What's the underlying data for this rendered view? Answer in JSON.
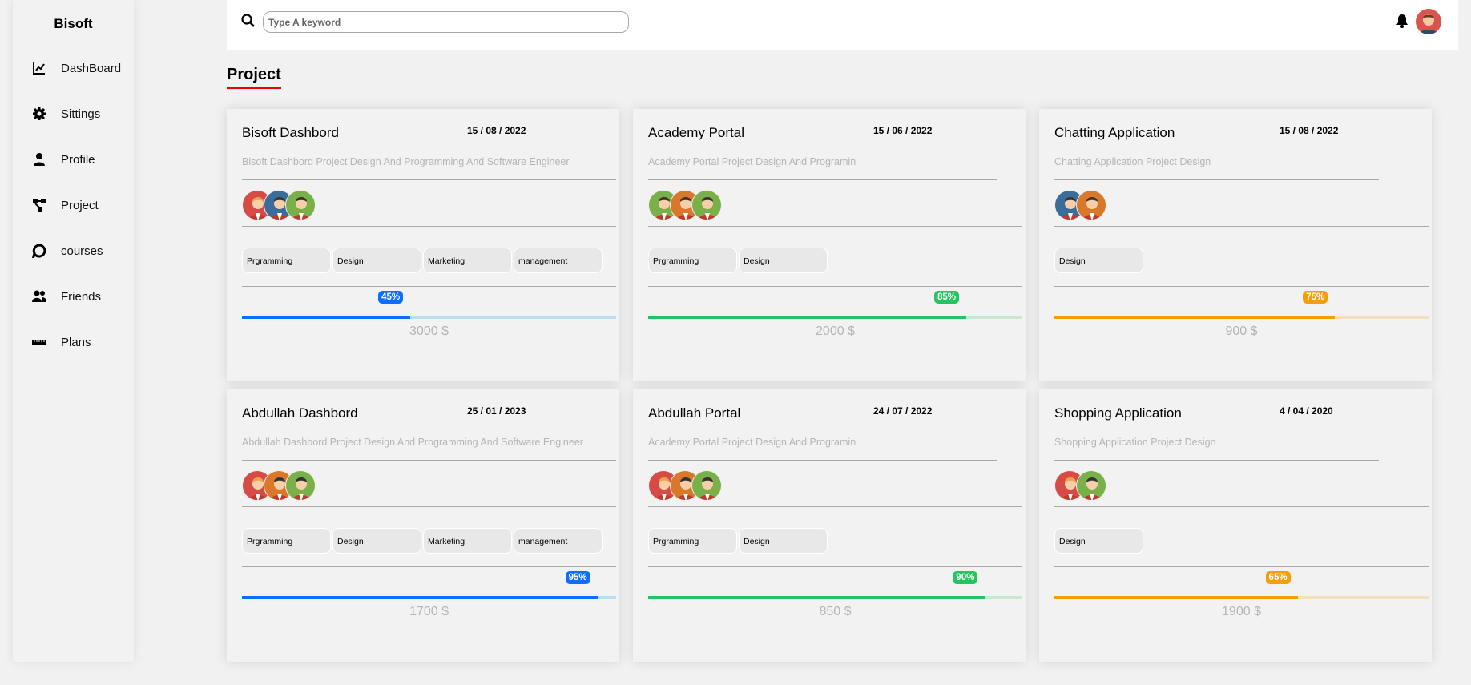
{
  "sidebar": {
    "brand": "Bisoft",
    "items": [
      {
        "label": "DashBoard",
        "icon": "chart-line-icon"
      },
      {
        "label": "Sittings",
        "icon": "gear-icon"
      },
      {
        "label": "Profile",
        "icon": "user-icon"
      },
      {
        "label": "Project",
        "icon": "diagram-project-icon"
      },
      {
        "label": "courses",
        "icon": "comment-icon"
      },
      {
        "label": "Friends",
        "icon": "users-icon"
      },
      {
        "label": "Plans",
        "icon": "ruler-icon"
      }
    ]
  },
  "header": {
    "search_placeholder": "Type A keyword"
  },
  "page": {
    "title": "Project"
  },
  "colors": {
    "blue": "#0d6efd",
    "green": "#22c55e",
    "orange": "#f59e0b"
  },
  "projects": [
    {
      "title": "Bisoft Dashbord",
      "date": "15 / 08 / 2022",
      "desc": "Bisoft Dashbord Project Design And Programming And Software Engineer",
      "avatars": [
        "red",
        "blue",
        "green"
      ],
      "tags": [
        "Prgramming",
        "Design",
        "Marketing",
        "management"
      ],
      "progress": 45,
      "progress_label": "45%",
      "color": "blue",
      "price": "3000 $"
    },
    {
      "title": "Academy Portal",
      "date": "15 / 06 / 2022",
      "desc": "Academy Portal Project Design And Programin",
      "avatars": [
        "green",
        "orange",
        "green"
      ],
      "tags": [
        "Prgramming",
        "Design"
      ],
      "progress": 85,
      "progress_label": "85%",
      "color": "green",
      "price": "2000 $"
    },
    {
      "title": "Chatting Application",
      "date": "15 / 08 / 2022",
      "desc": "Chatting Application Project Design",
      "avatars": [
        "blue",
        "orange"
      ],
      "tags": [
        "Design"
      ],
      "progress": 75,
      "progress_label": "75%",
      "color": "orange",
      "price": "900 $"
    },
    {
      "title": "Abdullah Dashbord",
      "date": "25 / 01 / 2023",
      "desc": "Abdullah Dashbord Project Design And Programming And Software Engineer",
      "avatars": [
        "red",
        "orange",
        "green"
      ],
      "tags": [
        "Prgramming",
        "Design",
        "Marketing",
        "management"
      ],
      "progress": 95,
      "progress_label": "95%",
      "color": "blue",
      "price": "1700 $"
    },
    {
      "title": "Abdullah Portal",
      "date": "24 / 07 / 2022",
      "desc": "Academy Portal Project Design And Programin",
      "avatars": [
        "red",
        "orange",
        "green"
      ],
      "tags": [
        "Prgramming",
        "Design"
      ],
      "progress": 90,
      "progress_label": "90%",
      "color": "green",
      "price": "850 $"
    },
    {
      "title": "Shopping Application",
      "date": "4 / 04 / 2020",
      "desc": "Shopping Application Project Design",
      "avatars": [
        "red",
        "green"
      ],
      "tags": [
        "Design"
      ],
      "progress": 65,
      "progress_label": "65%",
      "color": "orange",
      "price": "1900 $"
    }
  ]
}
